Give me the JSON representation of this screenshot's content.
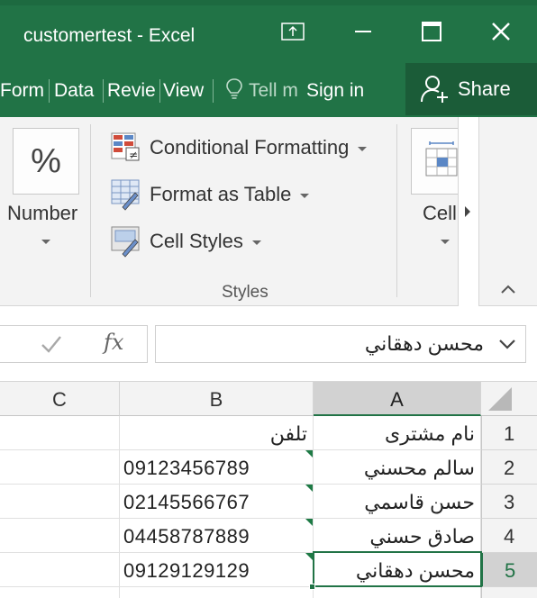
{
  "window": {
    "title": "customertest - Excel",
    "accent": "#217346"
  },
  "tabs": [
    {
      "label": "Form"
    },
    {
      "label": "Data"
    },
    {
      "label": "Revie"
    },
    {
      "label": "View"
    }
  ],
  "tell_me": "Tell me",
  "sign_in": "Sign in",
  "share": "Share",
  "ribbon": {
    "number_symbol": "%",
    "number_label": "Number",
    "styles": {
      "conditional_formatting": "Conditional Formatting",
      "format_as_table": "Format as Table",
      "cell_styles": "Cell Styles",
      "group_label": "Styles"
    },
    "cells_label": "Cell"
  },
  "formula_bar": {
    "fx": "fx",
    "value": "محسن دهقاني"
  },
  "grid": {
    "columns": [
      "C",
      "B",
      "A"
    ],
    "selected_column": "A",
    "rows": [
      {
        "num": "1",
        "a": "نام مشتری",
        "b": "تلفن"
      },
      {
        "num": "2",
        "a": "سالم محسني",
        "b": "09123456789"
      },
      {
        "num": "3",
        "a": "حسن قاسمي",
        "b": "02145566767"
      },
      {
        "num": "4",
        "a": "صادق حسني",
        "b": "04458787889"
      },
      {
        "num": "5",
        "a": "محسن دهقاني",
        "b": "09129129129"
      }
    ],
    "active_row": "5"
  }
}
